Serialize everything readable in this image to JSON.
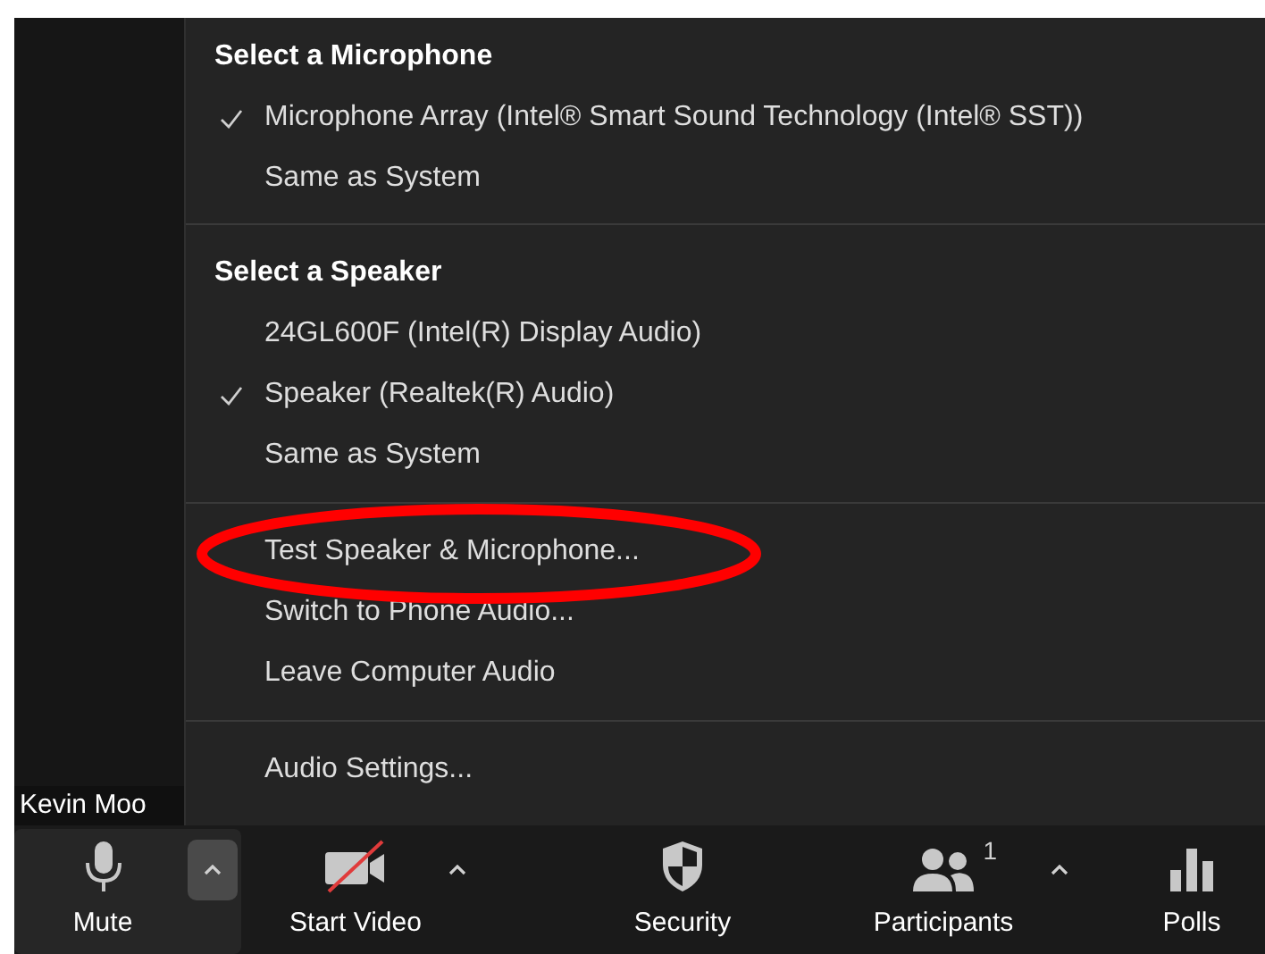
{
  "audio_menu": {
    "sections": [
      {
        "header": "Select a Microphone",
        "items": [
          {
            "label": "Microphone Array (Intel® Smart Sound Technology (Intel® SST))",
            "checked": true
          },
          {
            "label": "Same as System",
            "checked": false
          }
        ]
      },
      {
        "header": "Select a Speaker",
        "items": [
          {
            "label": "24GL600F (Intel(R) Display Audio)",
            "checked": false
          },
          {
            "label": "Speaker (Realtek(R) Audio)",
            "checked": true
          },
          {
            "label": "Same as System",
            "checked": false
          }
        ]
      },
      {
        "items": [
          {
            "label": "Test Speaker & Microphone...",
            "circled": true
          },
          {
            "label": "Switch to Phone Audio...",
            "circled": false
          },
          {
            "label": "Leave Computer Audio",
            "circled": false
          }
        ]
      },
      {
        "items": [
          {
            "label": "Audio Settings...",
            "circled": false
          }
        ]
      }
    ]
  },
  "video_tile": {
    "name": "Kevin Moo"
  },
  "toolbar": [
    {
      "kind": "mute",
      "label": "Mute",
      "selected": true,
      "caret": true
    },
    {
      "kind": "video",
      "label": "Start Video",
      "selected": false,
      "caret": true
    },
    {
      "kind": "security",
      "label": "Security",
      "selected": false,
      "caret": false
    },
    {
      "kind": "participants",
      "label": "Participants",
      "badge": "1",
      "selected": false,
      "caret": true
    },
    {
      "kind": "polls",
      "label": "Polls",
      "selected": false,
      "caret": false
    }
  ]
}
